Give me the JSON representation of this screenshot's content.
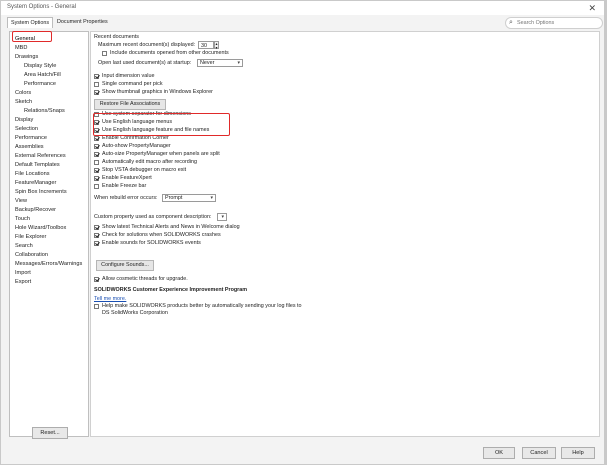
{
  "window": {
    "title": "System Options - General",
    "close_glyph": "✕"
  },
  "tabs": [
    {
      "label": "System Options"
    },
    {
      "label": "Document Properties"
    }
  ],
  "search": {
    "placeholder": "Search Options",
    "icon": "magnifier-icon"
  },
  "tree": {
    "items": [
      {
        "label": "General"
      },
      {
        "label": "MBD"
      },
      {
        "label": "Drawings"
      },
      {
        "label": "Display Style"
      },
      {
        "label": "Area Hatch/Fill"
      },
      {
        "label": "Performance"
      },
      {
        "label": "Colors"
      },
      {
        "label": "Sketch"
      },
      {
        "label": "Relations/Snaps"
      },
      {
        "label": "Display"
      },
      {
        "label": "Selection"
      },
      {
        "label": "Performance"
      },
      {
        "label": "Assemblies"
      },
      {
        "label": "External References"
      },
      {
        "label": "Default Templates"
      },
      {
        "label": "File Locations"
      },
      {
        "label": "FeatureManager"
      },
      {
        "label": "Spin Box Increments"
      },
      {
        "label": "View"
      },
      {
        "label": "Backup/Recover"
      },
      {
        "label": "Touch"
      },
      {
        "label": "Hole Wizard/Toolbox"
      },
      {
        "label": "File Explorer"
      },
      {
        "label": "Search"
      },
      {
        "label": "Collaboration"
      },
      {
        "label": "Messages/Errors/Warnings"
      },
      {
        "label": "Import"
      },
      {
        "label": "Export"
      }
    ],
    "reset_label": "Reset..."
  },
  "general": {
    "recent_title": "Recent documents",
    "max_recent_label": "Maximum recent document(s) displayed:",
    "max_recent_value": "30",
    "include_other_label": "Include documents opened from other documents",
    "open_last_label": "Open last used document(s) at startup:",
    "open_last_value": "Never",
    "checks1": [
      {
        "label": "Input dimension value",
        "checked": true
      },
      {
        "label": "Single command per pick",
        "checked": false
      },
      {
        "label": "Show thumbnail graphics in Windows Explorer",
        "checked": true
      }
    ],
    "restore_assoc_label": "Restore File Associations",
    "checks2": [
      {
        "label": "Use system separator for dimensions",
        "checked": false
      },
      {
        "label": "Use English language menus",
        "checked": true
      },
      {
        "label": "Use English language feature and file names",
        "checked": true
      },
      {
        "label": "Enable Confirmation Corner",
        "checked": true
      },
      {
        "label": "Auto-show PropertyManager",
        "checked": true
      },
      {
        "label": "Auto-size PropertyManager when panels are split",
        "checked": true
      },
      {
        "label": "Automatically edit macro after recording",
        "checked": false
      },
      {
        "label": "Stop VSTA debugger on macro exit",
        "checked": true
      },
      {
        "label": "Enable FeatureXpert",
        "checked": true
      },
      {
        "label": "Enable Freeze bar",
        "checked": false
      }
    ],
    "rebuild_error_label": "When rebuild error occurs:",
    "rebuild_error_value": "Prompt",
    "custom_prop_label": "Custom property used as component description:",
    "custom_prop_value": "",
    "checks3": [
      {
        "label": "Show latest Technical Alerts and News in Welcome dialog",
        "checked": true
      },
      {
        "label": "Check for solutions when SOLIDWORKS crashes",
        "checked": true
      },
      {
        "label": "Enable sounds for SOLIDWORKS events",
        "checked": true
      }
    ],
    "configure_sounds_label": "Configure Sounds...",
    "cosmetic_label": "Allow cosmetic threads for upgrade.",
    "cosmetic_checked": true,
    "ceip_title": "SOLIDWORKS Customer Experience Improvement Program",
    "tell_more_link": "Tell me more.",
    "help_make_line1": "Help make SOLIDWORKS products better by automatically sending your log files to",
    "help_make_line2": "DS SolidWorks Corporation",
    "help_make_checked": false
  },
  "footer": {
    "ok_label": "OK",
    "cancel_label": "Cancel",
    "help_label": "Help"
  },
  "colors": {
    "highlight": "#e02a2a",
    "link": "#1a4fb3"
  }
}
